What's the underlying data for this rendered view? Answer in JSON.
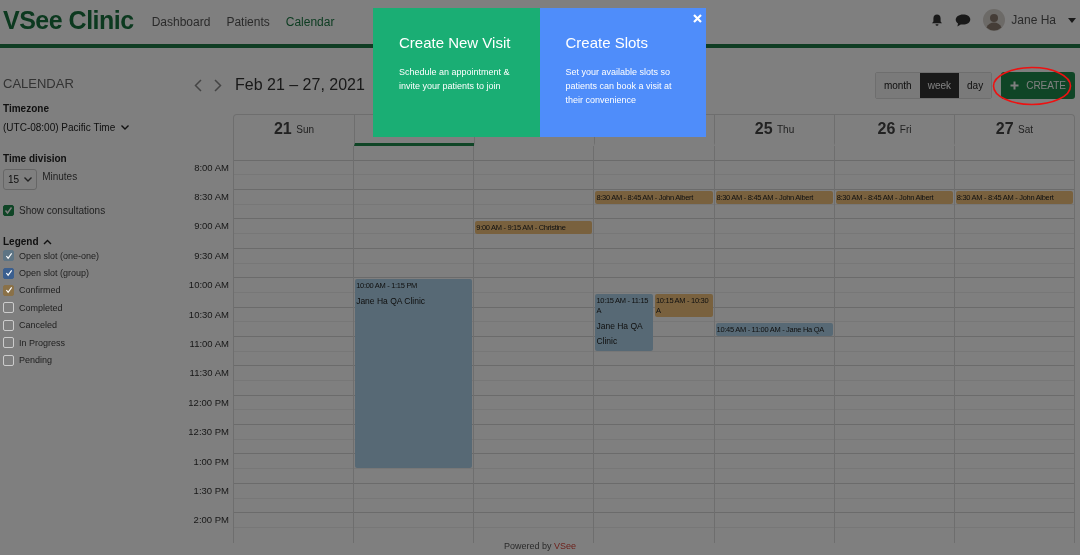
{
  "header": {
    "logo": "VSee Clinic",
    "nav": [
      {
        "label": "Dashboard",
        "selected": false
      },
      {
        "label": "Patients",
        "selected": false
      },
      {
        "label": "Calendar",
        "selected": true
      }
    ],
    "user": "Jane Ha"
  },
  "sidebar": {
    "title": "CALENDAR",
    "timezone": {
      "label": "Timezone",
      "value": "(UTC-08:00) Pacific Time"
    },
    "time_division": {
      "label": "Time division",
      "value": "15",
      "unit": "Minutes"
    },
    "show_consultations": {
      "label": "Show consultations",
      "checked": true
    },
    "legend": {
      "title": "Legend",
      "expanded": true,
      "items": [
        {
          "label": "Open slot (one-one)",
          "checked": true,
          "color": "#5d7484"
        },
        {
          "label": "Open slot (group)",
          "checked": true,
          "color": "#3b5f8f"
        },
        {
          "label": "Confirmed",
          "checked": true,
          "color": "#8a7148"
        },
        {
          "label": "Completed",
          "checked": false
        },
        {
          "label": "Canceled",
          "checked": false
        },
        {
          "label": "In Progress",
          "checked": false
        },
        {
          "label": "Pending",
          "checked": false
        }
      ]
    }
  },
  "toolbar": {
    "range": "Feb 21 – 27, 2021",
    "views": [
      {
        "label": "month",
        "selected": false
      },
      {
        "label": "week",
        "selected": true
      },
      {
        "label": "day",
        "selected": false
      }
    ],
    "create_button": {
      "label": "CREATE",
      "circled": true
    }
  },
  "calendar": {
    "days": [
      {
        "date": "21",
        "weekday": "Sun",
        "today": false
      },
      {
        "today": true,
        "events": [
          {
            "kind": "slot",
            "time": "10:00 AM - 1:15 PM",
            "title": "Jane Ha QA Clinic"
          }
        ]
      },
      {
        "today": false,
        "events": [
          {
            "kind": "confirmed",
            "time": "9:00 AM - 9:15 AM - Christine"
          }
        ]
      },
      {
        "today": false,
        "events": [
          {
            "kind": "confirmed",
            "time": "8:30 AM - 8:45 AM - John Albert"
          },
          {
            "kind": "slot",
            "time": "10:15 AM - 11:15 A",
            "title": "Jane Ha QA Clinic"
          },
          {
            "kind": "confirmed",
            "time": "10:15 AM - 10:30 A"
          }
        ]
      },
      {
        "date": "25",
        "weekday": "Thu",
        "today": false,
        "events": [
          {
            "kind": "confirmed",
            "time": "8:30 AM - 8:45 AM - John Albert"
          },
          {
            "kind": "slot",
            "time": "10:45 AM - 11:00 AM - Jane Ha QA"
          }
        ]
      },
      {
        "date": "26",
        "weekday": "Fri",
        "today": false,
        "events": [
          {
            "kind": "confirmed",
            "time": "8:30 AM - 8:45 AM - John Albert"
          }
        ]
      },
      {
        "date": "27",
        "weekday": "Sat",
        "today": false,
        "events": [
          {
            "kind": "confirmed",
            "time": "8:30 AM - 8:45 AM - John Albert"
          }
        ]
      }
    ],
    "times": [
      "8:00 AM",
      "8:30 AM",
      "9:00 AM",
      "9:30 AM",
      "10:00 AM",
      "10:30 AM",
      "11:00 AM",
      "11:30 AM",
      "12:00 PM",
      "12:30 PM",
      "1:00 PM",
      "1:30 PM",
      "2:00 PM"
    ]
  },
  "footer": {
    "text": "Powered by",
    "brand": "VSee"
  },
  "popup": {
    "cards": [
      {
        "title": "Create New Visit",
        "text": "Schedule an appointment & invite your patients to join",
        "color": "#1aae74"
      },
      {
        "title": "Create Slots",
        "text": "Set your available slots so patients can book a visit at their convenience",
        "color": "#4f8dfa"
      }
    ]
  }
}
